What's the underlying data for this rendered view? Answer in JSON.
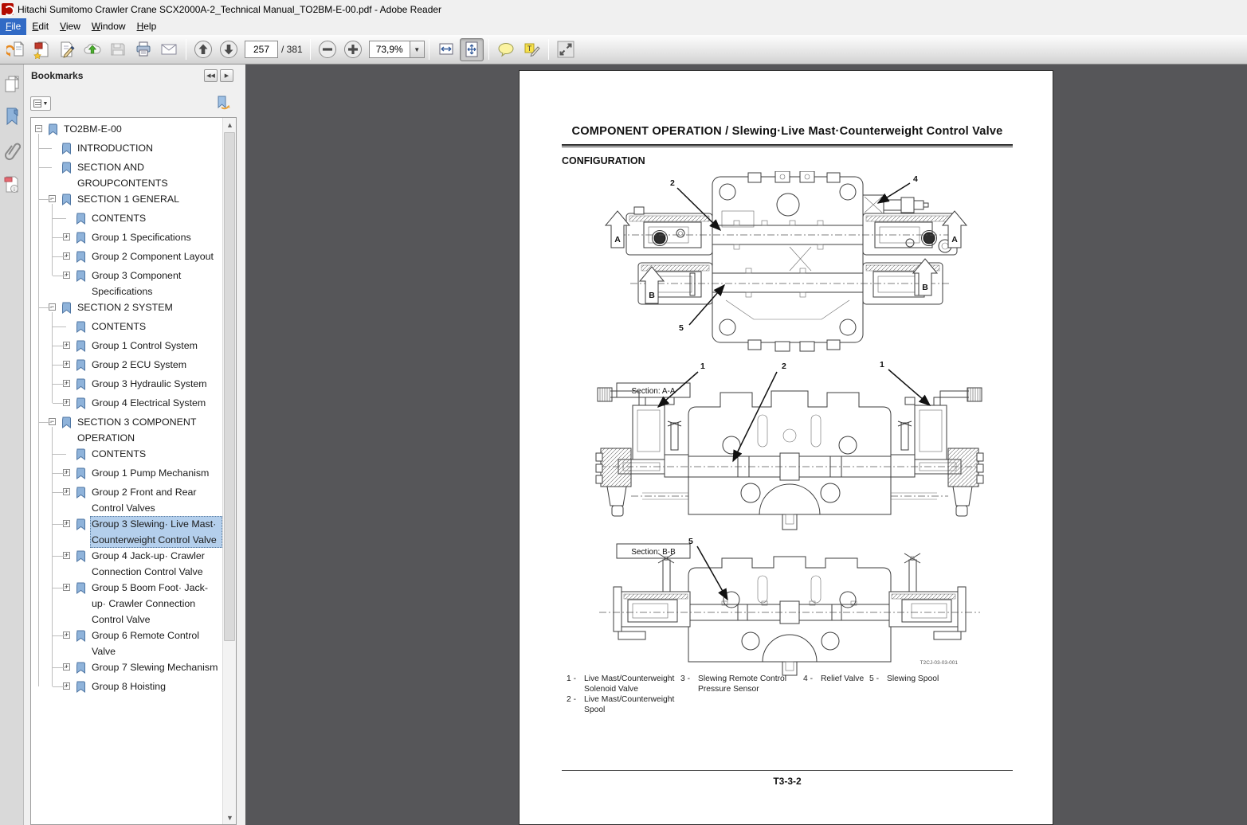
{
  "window": {
    "title": "Hitachi Sumitomo Crawler Crane SCX2000A-2_Technical Manual_TO2BM-E-00.pdf - Adobe Reader"
  },
  "menu_bar": {
    "items": [
      "File",
      "Edit",
      "View",
      "Window",
      "Help"
    ],
    "active_index": 0
  },
  "toolbar": {
    "page_current": "257",
    "page_total": "/ 381",
    "zoom_level": "73,9%"
  },
  "sidebar": {
    "header_title": "Bookmarks"
  },
  "bookmarks": {
    "items": [
      {
        "level": 0,
        "exp": "minus",
        "label": "TO2BM-E-00"
      },
      {
        "level": 1,
        "exp": "none",
        "label": "INTRODUCTION"
      },
      {
        "level": 1,
        "exp": "none",
        "label": "SECTION AND GROUPCONTENTS"
      },
      {
        "level": 1,
        "exp": "minus",
        "label": "SECTION 1 GENERAL"
      },
      {
        "level": 2,
        "exp": "none",
        "label": "CONTENTS"
      },
      {
        "level": 2,
        "exp": "plus",
        "label": "Group 1 Specifications"
      },
      {
        "level": 2,
        "exp": "plus",
        "label": "Group 2 Component Layout"
      },
      {
        "level": 2,
        "exp": "plus",
        "label": "Group 3 Component Specifications"
      },
      {
        "level": 1,
        "exp": "minus",
        "label": "SECTION 2 SYSTEM"
      },
      {
        "level": 2,
        "exp": "none",
        "label": "CONTENTS"
      },
      {
        "level": 2,
        "exp": "plus",
        "label": "Group 1 Control System"
      },
      {
        "level": 2,
        "exp": "plus",
        "label": "Group 2 ECU System"
      },
      {
        "level": 2,
        "exp": "plus",
        "label": "Group 3 Hydraulic System"
      },
      {
        "level": 2,
        "exp": "plus",
        "label": "Group 4 Electrical System"
      },
      {
        "level": 1,
        "exp": "minus",
        "label": "SECTION 3 COMPONENT OPERATION"
      },
      {
        "level": 2,
        "exp": "none",
        "label": "CONTENTS"
      },
      {
        "level": 2,
        "exp": "plus",
        "label": "Group 1 Pump Mechanism"
      },
      {
        "level": 2,
        "exp": "plus",
        "label": "Group 2 Front and Rear Control Valves"
      },
      {
        "level": 2,
        "exp": "plus",
        "label": "Group 3 Slewing· Live Mast· Counterweight Control Valve",
        "selected": true
      },
      {
        "level": 2,
        "exp": "plus",
        "label": "Group 4 Jack-up· Crawler Connection Control Valve"
      },
      {
        "level": 2,
        "exp": "plus",
        "label": "Group 5 Boom Foot· Jack-up· Crawler Connection Control Valve"
      },
      {
        "level": 2,
        "exp": "plus",
        "label": "Group 6 Remote Control Valve"
      },
      {
        "level": 2,
        "exp": "plus",
        "label": "Group 7 Slewing Mechanism"
      },
      {
        "level": 2,
        "exp": "plus",
        "label": "Group 8 Hoisting"
      }
    ]
  },
  "document": {
    "title": "COMPONENT OPERATION / Slewing·Live Mast·Counterweight Control Valve",
    "section_heading": "CONFIGURATION",
    "figure_code": "T2CJ-03-03-001",
    "page_label": "T3-3-2",
    "diagrams": {
      "plan": {
        "labels": {
          "l2": "2",
          "l4": "4",
          "l5": "5",
          "arrow_a": "A",
          "arrow_b": "B"
        }
      },
      "section_aa": {
        "caption": "Section: A-A",
        "labels": {
          "l1": "1",
          "l2": "2"
        }
      },
      "section_bb": {
        "caption": "Section: B-B",
        "labels": {
          "l5": "5"
        }
      }
    },
    "legend": [
      {
        "num": "1 -",
        "text": "Live Mast/Counterweight Solenoid Valve"
      },
      {
        "num": "2 -",
        "text": "Live Mast/Counterweight Spool"
      },
      {
        "num": "3 -",
        "text": "Slewing Remote Control Pressure Sensor"
      },
      {
        "num": "4 -",
        "text": "Relief Valve"
      },
      {
        "num": "5 -",
        "text": "Slewing Spool"
      }
    ],
    "legend_columns": [
      [
        0,
        1
      ],
      [
        2
      ],
      [
        3
      ],
      [
        4
      ]
    ],
    "legend_layout": {
      "lefts": [
        59,
        202,
        356,
        439
      ],
      "widths": [
        160,
        172,
        112,
        130
      ]
    }
  },
  "colors": {
    "accent_selection": "#b4cfec",
    "menu_highlight": "#316ac5",
    "doc_background": "#565659"
  }
}
